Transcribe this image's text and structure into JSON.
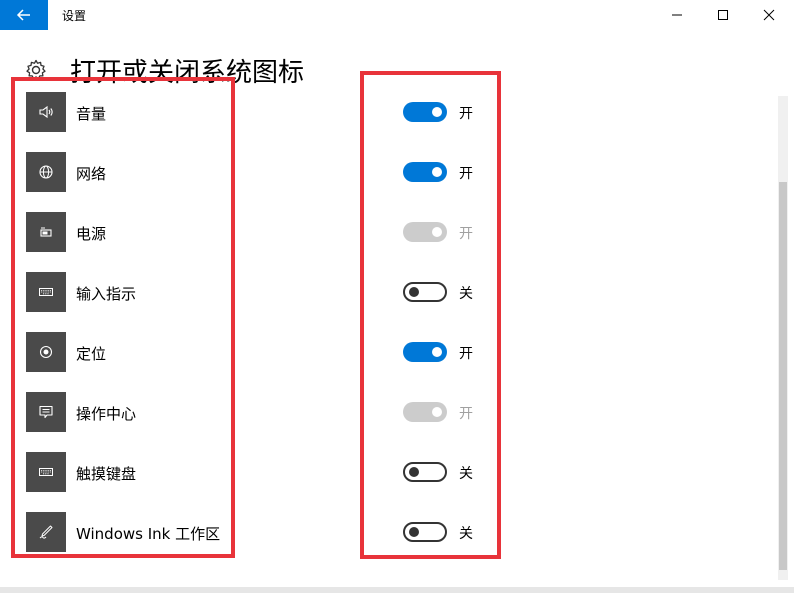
{
  "window": {
    "title": "设置",
    "controls": [
      "minimize-icon",
      "maximize-icon",
      "close-icon"
    ]
  },
  "header": {
    "icon": "gear-icon",
    "title": "打开或关闭系统图标"
  },
  "items": [
    {
      "label": "音量",
      "icon": "speaker-icon",
      "state": "开",
      "on": true,
      "enabled": true
    },
    {
      "label": "网络",
      "icon": "globe-icon",
      "state": "开",
      "on": true,
      "enabled": true
    },
    {
      "label": "电源",
      "icon": "battery-icon",
      "state": "开",
      "on": true,
      "enabled": false
    },
    {
      "label": "输入指示",
      "icon": "keyboard-icon",
      "state": "关",
      "on": false,
      "enabled": true
    },
    {
      "label": "定位",
      "icon": "location-icon",
      "state": "开",
      "on": true,
      "enabled": true
    },
    {
      "label": "操作中心",
      "icon": "action-center-icon",
      "state": "开",
      "on": true,
      "enabled": false
    },
    {
      "label": "触摸键盘",
      "icon": "touch-keyboard-icon",
      "state": "关",
      "on": false,
      "enabled": true
    },
    {
      "label": "Windows Ink 工作区",
      "icon": "pen-icon",
      "state": "关",
      "on": false,
      "enabled": true
    }
  ],
  "colors": {
    "accent": "#0078d7",
    "highlight": "#e8333a",
    "tile": "#4a4a4a",
    "disabled": "#cccccc"
  }
}
